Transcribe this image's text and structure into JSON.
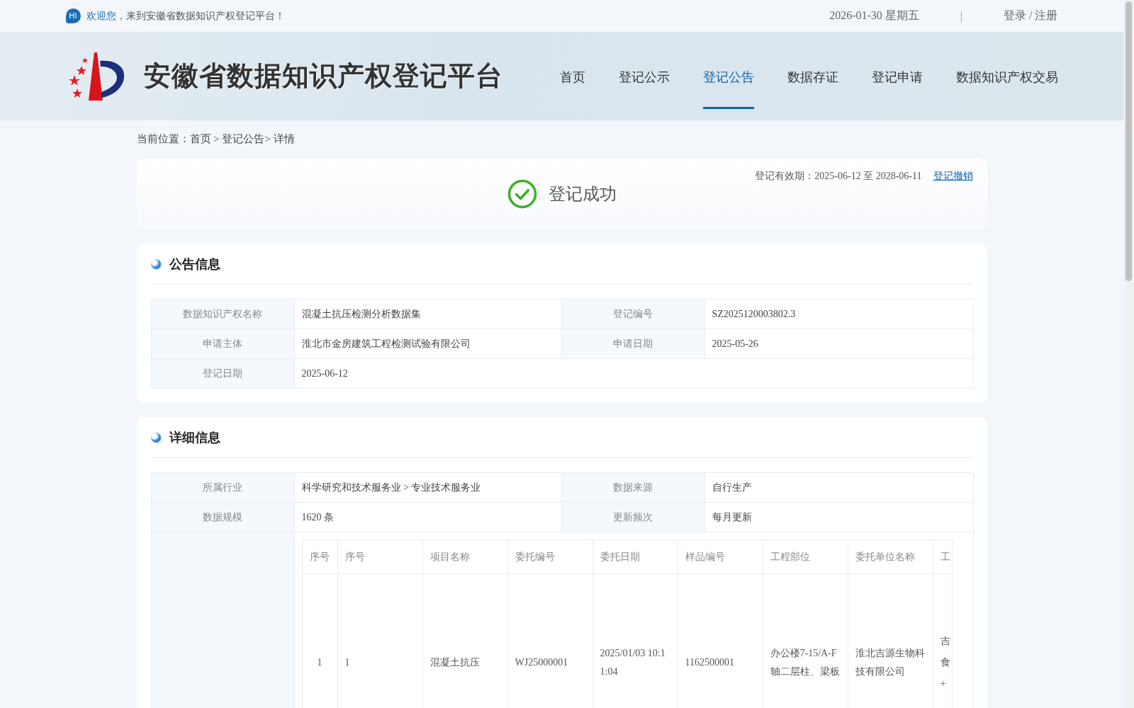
{
  "topbar": {
    "hi_badge": "Hi",
    "welcome_highlight": "欢迎您，",
    "welcome_rest": "来到安徽省数据知识产权登记平台！",
    "date": "2026-01-30 星期五",
    "separator": "|",
    "login": "登录 / 注册"
  },
  "header": {
    "site_title": "安徽省数据知识产权登记平台"
  },
  "nav": [
    {
      "label": "首页",
      "selected": false
    },
    {
      "label": "登记公示",
      "selected": false
    },
    {
      "label": "登记公告",
      "selected": true
    },
    {
      "label": "数据存证",
      "selected": false
    },
    {
      "label": "登记申请",
      "selected": false
    },
    {
      "label": "数据知识产权交易",
      "selected": false
    }
  ],
  "breadcrumb": {
    "label": "当前位置：",
    "path": "首页 > 登记公告> 详情"
  },
  "status": {
    "text": "登记成功",
    "validity": "登记有效期：2025-06-12 至 2028-06-11",
    "revoke_link": "登记撤销"
  },
  "sections": [
    {
      "title": "公告信息",
      "rows": [
        [
          {
            "label": "数据知识产权名称",
            "value": "混凝土抗压检测分析数据集"
          },
          {
            "label": "登记编号",
            "value": "SZ2025120003802.3"
          }
        ],
        [
          {
            "label": "申请主体",
            "value": "淮北市金房建筑工程检测试验有限公司"
          },
          {
            "label": "申请日期",
            "value": "2025-05-26"
          }
        ],
        [
          {
            "label": "登记日期",
            "value": "2025-06-12"
          }
        ]
      ]
    },
    {
      "title": "详细信息",
      "rows": [
        [
          {
            "label": "所属行业",
            "value": "科学研究和技术服务业 > 专业技术服务业"
          },
          {
            "label": "数据来源",
            "value": "自行生产"
          }
        ],
        [
          {
            "label": "数据规模",
            "value": "1620 条"
          },
          {
            "label": "更新频次",
            "value": "每月更新"
          }
        ]
      ],
      "sample_table": {
        "columns": [
          "序号",
          "序号",
          "项目名称",
          "委托编号",
          "委托日期",
          "样品编号",
          "工程部位",
          "委托单位名称",
          "工"
        ],
        "rows": [
          [
            "1",
            "1",
            "混凝土抗压",
            "WJ25000001",
            "2025/01/03 10:11:04",
            "1162500001",
            "办公楼7-15/A-F轴二层柱、梁板",
            "淮北吉源生物科技有限公司",
            "吉食+"
          ]
        ]
      }
    }
  ]
}
